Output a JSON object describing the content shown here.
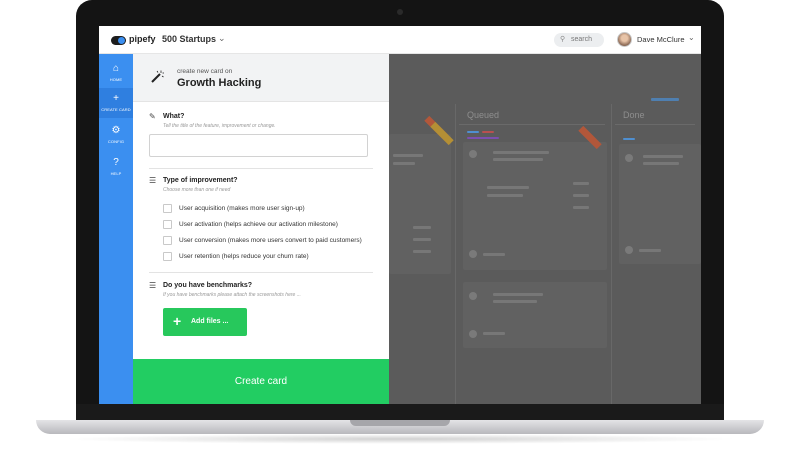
{
  "app": {
    "brand": "pipefy",
    "organization": "500 Startups",
    "org_caret": "⌄",
    "search_placeholder": "search",
    "user_name": "Dave McClure",
    "user_caret": "⌄"
  },
  "sidebar": {
    "items": [
      {
        "label": "HOME",
        "icon": "home-icon",
        "glyph": "⌂"
      },
      {
        "label": "CREATE CARD",
        "icon": "plus-icon",
        "glyph": "+"
      },
      {
        "label": "CONFIG",
        "icon": "gear-icon",
        "glyph": "⚙"
      },
      {
        "label": "HELP",
        "icon": "help-icon",
        "glyph": "?"
      }
    ]
  },
  "form": {
    "subtitle": "create new card on",
    "pipe_name": "Growth Hacking",
    "what": {
      "label": "What?",
      "hint": "Tell the title of the feature, improvement or change.",
      "value": ""
    },
    "type": {
      "label": "Type of improvement?",
      "hint": "Choose more than one if need",
      "options": [
        "User acquisition (makes more user sign-up)",
        "User activation (helps achieve our activation milestone)",
        "User conversion (makes more users convert to paid customers)",
        "User retention (helps reduce your churn rate)"
      ]
    },
    "benchmarks": {
      "label": "Do you have benchmarks?",
      "hint": "If you have benchmarks please attach the screenshots here ...",
      "add_files": "Add files ..."
    },
    "submit": "Create card"
  },
  "board": {
    "columns": [
      "Queued",
      "Done"
    ]
  },
  "colors": {
    "accent_blue": "#3b8ff0",
    "create_green": "#22cd62",
    "overlay": "#5b5b5b"
  }
}
